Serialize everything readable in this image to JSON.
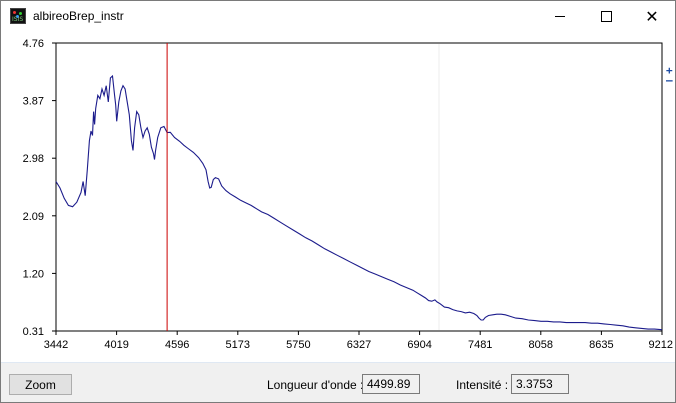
{
  "window": {
    "title": "albireoBrep_instr",
    "icon": "isis-app-icon",
    "icon_text": "ISIS",
    "controls": [
      "minimize-icon",
      "maximize-icon",
      "close-icon"
    ]
  },
  "zoom_controls": {
    "plus": "+",
    "minus": "–"
  },
  "bottombar": {
    "zoom_label": "Zoom",
    "wavelength_label": "Longueur d'onde :",
    "wavelength_value": "4499.89",
    "intensity_label": "Intensité :",
    "intensity_value": "3.3753"
  },
  "colors": {
    "spectrum": "#1c1c8c",
    "cursor": "#cc0000",
    "bottombar": "#f0f0f0"
  },
  "chart_data": {
    "type": "line",
    "xlim": [
      3442,
      9212
    ],
    "ylim": [
      0.31,
      4.76
    ],
    "x_ticks": [
      3442,
      4019,
      4596,
      5173,
      5750,
      6327,
      6904,
      7481,
      8058,
      8635,
      9212
    ],
    "y_ticks": [
      "0.31",
      "1.20",
      "2.09",
      "2.98",
      "3.87",
      "4.76"
    ],
    "cursor_x": 4499.89,
    "grid": false,
    "series": [
      {
        "points": [
          [
            3442,
            2.62
          ],
          [
            3480,
            2.52
          ],
          [
            3520,
            2.36
          ],
          [
            3560,
            2.25
          ],
          [
            3600,
            2.23
          ],
          [
            3640,
            2.3
          ],
          [
            3680,
            2.45
          ],
          [
            3700,
            2.62
          ],
          [
            3720,
            2.4
          ],
          [
            3740,
            2.8
          ],
          [
            3760,
            3.25
          ],
          [
            3775,
            3.4
          ],
          [
            3790,
            3.33
          ],
          [
            3800,
            3.7
          ],
          [
            3810,
            3.5
          ],
          [
            3820,
            3.75
          ],
          [
            3840,
            3.95
          ],
          [
            3860,
            3.9
          ],
          [
            3880,
            4.05
          ],
          [
            3900,
            3.95
          ],
          [
            3920,
            4.1
          ],
          [
            3940,
            3.85
          ],
          [
            3960,
            4.22
          ],
          [
            3980,
            4.25
          ],
          [
            4000,
            3.95
          ],
          [
            4010,
            3.8
          ],
          [
            4020,
            3.55
          ],
          [
            4040,
            3.85
          ],
          [
            4060,
            4.02
          ],
          [
            4080,
            4.1
          ],
          [
            4100,
            4.05
          ],
          [
            4120,
            3.85
          ],
          [
            4140,
            3.65
          ],
          [
            4160,
            3.25
          ],
          [
            4175,
            3.1
          ],
          [
            4190,
            3.45
          ],
          [
            4210,
            3.7
          ],
          [
            4230,
            3.65
          ],
          [
            4250,
            3.45
          ],
          [
            4270,
            3.3
          ],
          [
            4290,
            3.4
          ],
          [
            4310,
            3.45
          ],
          [
            4330,
            3.35
          ],
          [
            4350,
            3.15
          ],
          [
            4370,
            3.05
          ],
          [
            4380,
            2.96
          ],
          [
            4390,
            3.1
          ],
          [
            4410,
            3.3
          ],
          [
            4440,
            3.45
          ],
          [
            4470,
            3.47
          ],
          [
            4499.89,
            3.3753
          ],
          [
            4530,
            3.38
          ],
          [
            4570,
            3.3
          ],
          [
            4620,
            3.24
          ],
          [
            4660,
            3.18
          ],
          [
            4700,
            3.13
          ],
          [
            4750,
            3.07
          ],
          [
            4800,
            2.99
          ],
          [
            4840,
            2.9
          ],
          [
            4870,
            2.8
          ],
          [
            4890,
            2.62
          ],
          [
            4905,
            2.52
          ],
          [
            4920,
            2.53
          ],
          [
            4940,
            2.65
          ],
          [
            4960,
            2.68
          ],
          [
            4990,
            2.66
          ],
          [
            5020,
            2.55
          ],
          [
            5060,
            2.48
          ],
          [
            5100,
            2.43
          ],
          [
            5150,
            2.38
          ],
          [
            5200,
            2.33
          ],
          [
            5250,
            2.29
          ],
          [
            5300,
            2.25
          ],
          [
            5350,
            2.2
          ],
          [
            5400,
            2.15
          ],
          [
            5460,
            2.11
          ],
          [
            5520,
            2.05
          ],
          [
            5580,
            1.99
          ],
          [
            5640,
            1.93
          ],
          [
            5700,
            1.87
          ],
          [
            5760,
            1.81
          ],
          [
            5820,
            1.75
          ],
          [
            5880,
            1.7
          ],
          [
            5940,
            1.64
          ],
          [
            6000,
            1.58
          ],
          [
            6060,
            1.53
          ],
          [
            6120,
            1.48
          ],
          [
            6180,
            1.43
          ],
          [
            6240,
            1.38
          ],
          [
            6300,
            1.33
          ],
          [
            6360,
            1.28
          ],
          [
            6420,
            1.23
          ],
          [
            6480,
            1.19
          ],
          [
            6540,
            1.15
          ],
          [
            6600,
            1.11
          ],
          [
            6660,
            1.07
          ],
          [
            6720,
            1.02
          ],
          [
            6780,
            0.98
          ],
          [
            6840,
            0.94
          ],
          [
            6880,
            0.9
          ],
          [
            6920,
            0.86
          ],
          [
            6960,
            0.82
          ],
          [
            6990,
            0.78
          ],
          [
            7020,
            0.77
          ],
          [
            7050,
            0.79
          ],
          [
            7070,
            0.76
          ],
          [
            7100,
            0.73
          ],
          [
            7140,
            0.68
          ],
          [
            7180,
            0.67
          ],
          [
            7220,
            0.64
          ],
          [
            7260,
            0.62
          ],
          [
            7300,
            0.61
          ],
          [
            7340,
            0.59
          ],
          [
            7380,
            0.6
          ],
          [
            7420,
            0.58
          ],
          [
            7450,
            0.55
          ],
          [
            7470,
            0.51
          ],
          [
            7490,
            0.48
          ],
          [
            7510,
            0.48
          ],
          [
            7530,
            0.52
          ],
          [
            7560,
            0.55
          ],
          [
            7600,
            0.56
          ],
          [
            7640,
            0.57
          ],
          [
            7680,
            0.57
          ],
          [
            7720,
            0.56
          ],
          [
            7760,
            0.54
          ],
          [
            7820,
            0.51
          ],
          [
            7880,
            0.5
          ],
          [
            7940,
            0.48
          ],
          [
            8000,
            0.47
          ],
          [
            8060,
            0.46
          ],
          [
            8120,
            0.46
          ],
          [
            8180,
            0.45
          ],
          [
            8240,
            0.45
          ],
          [
            8300,
            0.44
          ],
          [
            8360,
            0.44
          ],
          [
            8420,
            0.44
          ],
          [
            8480,
            0.44
          ],
          [
            8540,
            0.43
          ],
          [
            8600,
            0.43
          ],
          [
            8660,
            0.42
          ],
          [
            8720,
            0.41
          ],
          [
            8780,
            0.4
          ],
          [
            8840,
            0.39
          ],
          [
            8900,
            0.37
          ],
          [
            8960,
            0.36
          ],
          [
            9020,
            0.35
          ],
          [
            9080,
            0.34
          ],
          [
            9140,
            0.34
          ],
          [
            9212,
            0.33
          ]
        ]
      }
    ]
  }
}
